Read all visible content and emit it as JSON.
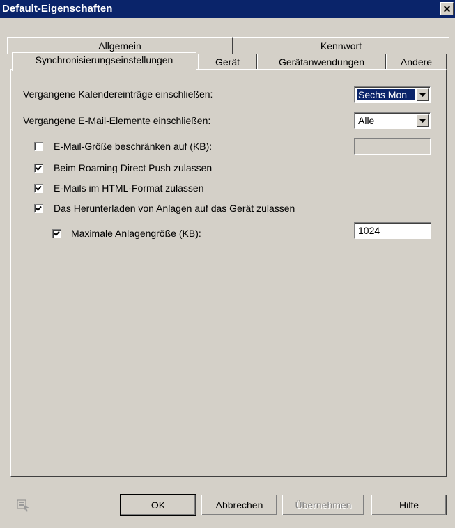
{
  "window": {
    "title": "Default-Eigenschaften",
    "close_symbol": "✕"
  },
  "tabs": {
    "row_back": [
      "Allgemein",
      "Kennwort"
    ],
    "row_front": [
      "Synchronisierungseinstellungen",
      "Gerät",
      "Gerätanwendungen",
      "Andere"
    ],
    "active": "Synchronisierungseinstellungen"
  },
  "settings": {
    "calendar_label": "Vergangene Kalendereinträge einschließen:",
    "calendar_value": "Sechs Mon",
    "email_label": "Vergangene E-Mail-Elemente einschließen:",
    "email_value": "Alle",
    "size_limit_label": "E-Mail-Größe beschränken auf (KB):",
    "size_limit_checked": false,
    "size_limit_value": "",
    "roaming_label": "Beim Roaming Direct Push zulassen",
    "roaming_checked": true,
    "html_label": "E-Mails im HTML-Format zulassen",
    "html_checked": true,
    "attachments_label": "Das Herunterladen von Anlagen auf das Gerät zulassen",
    "attachments_checked": true,
    "max_attachment_label": "Maximale Anlagengröße (KB):",
    "max_attachment_checked": true,
    "max_attachment_value": "1024"
  },
  "buttons": {
    "ok": "OK",
    "cancel": "Abbrechen",
    "apply": "Übernehmen",
    "help": "Hilfe"
  },
  "icons": {
    "close": "close-icon",
    "dropdown": "chevron-down-icon",
    "check": "check-icon",
    "help": "context-help-icon"
  },
  "colors": {
    "titlebar": "#0a246a",
    "face": "#d4d0c8",
    "selection": "#0a246a"
  }
}
